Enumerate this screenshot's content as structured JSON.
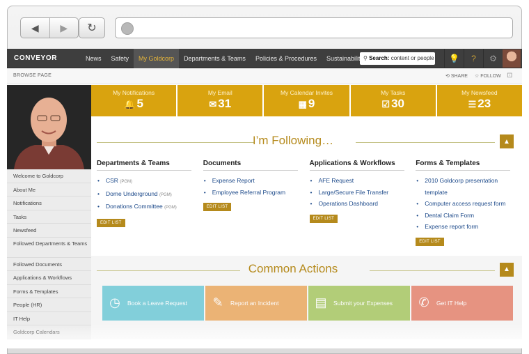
{
  "brand": "CONVEYOR",
  "menu": [
    "News",
    "Safety",
    "My Goldcorp",
    "Departments & Teams",
    "Policies & Procedures",
    "Sustainability"
  ],
  "search": {
    "bold": "Search:",
    "placeholder": "content or people"
  },
  "subnav": {
    "browse": "BROWSE",
    "page": "PAGE",
    "share": "SHARE",
    "follow": "FOLLOW"
  },
  "sidebar": [
    "Welcome to Goldcorp",
    "About Me",
    "Notifications",
    "Tasks",
    "Newsfeed",
    "Followed Departments & Teams",
    "Followed Documents",
    "Applications & Workflows",
    "Forms & Templates",
    "People (HR)",
    "IT Help",
    "Goldcorp Calendars"
  ],
  "stats": [
    {
      "label": "My Notifications",
      "icon": "bell-icon",
      "glyph": "🔔",
      "count": "5"
    },
    {
      "label": "My Email",
      "icon": "envelope-icon",
      "glyph": "✉",
      "count": "31"
    },
    {
      "label": "My Calendar Invites",
      "icon": "calendar-icon",
      "glyph": "▦",
      "count": "9"
    },
    {
      "label": "My Tasks",
      "icon": "checkbox-icon",
      "glyph": "☑",
      "count": "30"
    },
    {
      "label": "My Newsfeed",
      "icon": "list-icon",
      "glyph": "☰",
      "count": "23"
    }
  ],
  "following_title": "I’m Following…",
  "columns": [
    {
      "title": "Departments & Teams",
      "items": [
        {
          "text": "CSR",
          "tag": "(PGM)"
        },
        {
          "text": "Dome Underground",
          "tag": "(PGM)"
        },
        {
          "text": "Donations Committee",
          "tag": "(PGM)"
        }
      ]
    },
    {
      "title": "Documents",
      "items": [
        {
          "text": "Expense Report",
          "tag": ""
        },
        {
          "text": "Employee Referral Program",
          "tag": ""
        }
      ]
    },
    {
      "title": "Applications & Workflows",
      "items": [
        {
          "text": "AFE Request",
          "tag": ""
        },
        {
          "text": "Large/Secure File Transfer",
          "tag": ""
        },
        {
          "text": "Operations Dashboard",
          "tag": ""
        }
      ]
    },
    {
      "title": "Forms & Templates",
      "items": [
        {
          "text": "2010 Goldcorp presentation template",
          "tag": ""
        },
        {
          "text": "Computer access request form",
          "tag": ""
        },
        {
          "text": "Dental Claim Form",
          "tag": ""
        },
        {
          "text": "Expense report form",
          "tag": ""
        }
      ]
    }
  ],
  "edit_label": "EDIT LIST",
  "common_title": "Common Actions",
  "actions": [
    {
      "label": "Book a Leave Request",
      "icon": "clock-icon",
      "glyph": "◷",
      "color": "#5cc3d2"
    },
    {
      "label": "Report an Incident",
      "icon": "pencil-icon",
      "glyph": "✎",
      "color": "#e89d4b"
    },
    {
      "label": "Submit your Expenses",
      "icon": "receipt-icon",
      "glyph": "▤",
      "color": "#9cc04f"
    },
    {
      "label": "Get IT Help",
      "icon": "phone-icon",
      "glyph": "✆",
      "color": "#e2735b"
    }
  ]
}
